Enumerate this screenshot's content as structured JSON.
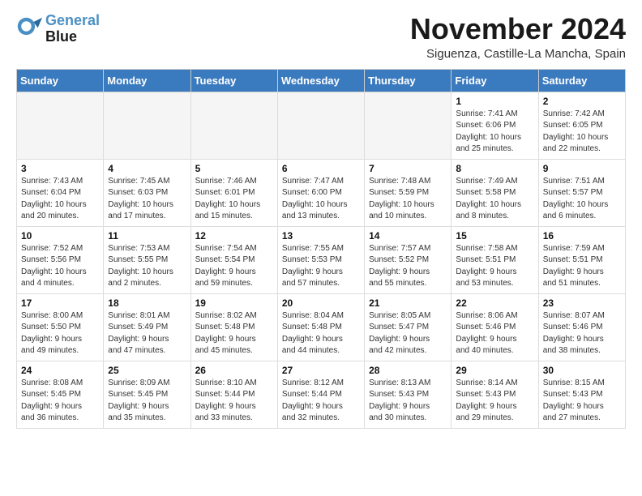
{
  "logo": {
    "line1": "General",
    "line2": "Blue"
  },
  "title": "November 2024",
  "subtitle": "Siguenza, Castille-La Mancha, Spain",
  "headers": [
    "Sunday",
    "Monday",
    "Tuesday",
    "Wednesday",
    "Thursday",
    "Friday",
    "Saturday"
  ],
  "weeks": [
    [
      {
        "day": "",
        "info": ""
      },
      {
        "day": "",
        "info": ""
      },
      {
        "day": "",
        "info": ""
      },
      {
        "day": "",
        "info": ""
      },
      {
        "day": "",
        "info": ""
      },
      {
        "day": "1",
        "info": "Sunrise: 7:41 AM\nSunset: 6:06 PM\nDaylight: 10 hours\nand 25 minutes."
      },
      {
        "day": "2",
        "info": "Sunrise: 7:42 AM\nSunset: 6:05 PM\nDaylight: 10 hours\nand 22 minutes."
      }
    ],
    [
      {
        "day": "3",
        "info": "Sunrise: 7:43 AM\nSunset: 6:04 PM\nDaylight: 10 hours\nand 20 minutes."
      },
      {
        "day": "4",
        "info": "Sunrise: 7:45 AM\nSunset: 6:03 PM\nDaylight: 10 hours\nand 17 minutes."
      },
      {
        "day": "5",
        "info": "Sunrise: 7:46 AM\nSunset: 6:01 PM\nDaylight: 10 hours\nand 15 minutes."
      },
      {
        "day": "6",
        "info": "Sunrise: 7:47 AM\nSunset: 6:00 PM\nDaylight: 10 hours\nand 13 minutes."
      },
      {
        "day": "7",
        "info": "Sunrise: 7:48 AM\nSunset: 5:59 PM\nDaylight: 10 hours\nand 10 minutes."
      },
      {
        "day": "8",
        "info": "Sunrise: 7:49 AM\nSunset: 5:58 PM\nDaylight: 10 hours\nand 8 minutes."
      },
      {
        "day": "9",
        "info": "Sunrise: 7:51 AM\nSunset: 5:57 PM\nDaylight: 10 hours\nand 6 minutes."
      }
    ],
    [
      {
        "day": "10",
        "info": "Sunrise: 7:52 AM\nSunset: 5:56 PM\nDaylight: 10 hours\nand 4 minutes."
      },
      {
        "day": "11",
        "info": "Sunrise: 7:53 AM\nSunset: 5:55 PM\nDaylight: 10 hours\nand 2 minutes."
      },
      {
        "day": "12",
        "info": "Sunrise: 7:54 AM\nSunset: 5:54 PM\nDaylight: 9 hours\nand 59 minutes."
      },
      {
        "day": "13",
        "info": "Sunrise: 7:55 AM\nSunset: 5:53 PM\nDaylight: 9 hours\nand 57 minutes."
      },
      {
        "day": "14",
        "info": "Sunrise: 7:57 AM\nSunset: 5:52 PM\nDaylight: 9 hours\nand 55 minutes."
      },
      {
        "day": "15",
        "info": "Sunrise: 7:58 AM\nSunset: 5:51 PM\nDaylight: 9 hours\nand 53 minutes."
      },
      {
        "day": "16",
        "info": "Sunrise: 7:59 AM\nSunset: 5:51 PM\nDaylight: 9 hours\nand 51 minutes."
      }
    ],
    [
      {
        "day": "17",
        "info": "Sunrise: 8:00 AM\nSunset: 5:50 PM\nDaylight: 9 hours\nand 49 minutes."
      },
      {
        "day": "18",
        "info": "Sunrise: 8:01 AM\nSunset: 5:49 PM\nDaylight: 9 hours\nand 47 minutes."
      },
      {
        "day": "19",
        "info": "Sunrise: 8:02 AM\nSunset: 5:48 PM\nDaylight: 9 hours\nand 45 minutes."
      },
      {
        "day": "20",
        "info": "Sunrise: 8:04 AM\nSunset: 5:48 PM\nDaylight: 9 hours\nand 44 minutes."
      },
      {
        "day": "21",
        "info": "Sunrise: 8:05 AM\nSunset: 5:47 PM\nDaylight: 9 hours\nand 42 minutes."
      },
      {
        "day": "22",
        "info": "Sunrise: 8:06 AM\nSunset: 5:46 PM\nDaylight: 9 hours\nand 40 minutes."
      },
      {
        "day": "23",
        "info": "Sunrise: 8:07 AM\nSunset: 5:46 PM\nDaylight: 9 hours\nand 38 minutes."
      }
    ],
    [
      {
        "day": "24",
        "info": "Sunrise: 8:08 AM\nSunset: 5:45 PM\nDaylight: 9 hours\nand 36 minutes."
      },
      {
        "day": "25",
        "info": "Sunrise: 8:09 AM\nSunset: 5:45 PM\nDaylight: 9 hours\nand 35 minutes."
      },
      {
        "day": "26",
        "info": "Sunrise: 8:10 AM\nSunset: 5:44 PM\nDaylight: 9 hours\nand 33 minutes."
      },
      {
        "day": "27",
        "info": "Sunrise: 8:12 AM\nSunset: 5:44 PM\nDaylight: 9 hours\nand 32 minutes."
      },
      {
        "day": "28",
        "info": "Sunrise: 8:13 AM\nSunset: 5:43 PM\nDaylight: 9 hours\nand 30 minutes."
      },
      {
        "day": "29",
        "info": "Sunrise: 8:14 AM\nSunset: 5:43 PM\nDaylight: 9 hours\nand 29 minutes."
      },
      {
        "day": "30",
        "info": "Sunrise: 8:15 AM\nSunset: 5:43 PM\nDaylight: 9 hours\nand 27 minutes."
      }
    ]
  ]
}
